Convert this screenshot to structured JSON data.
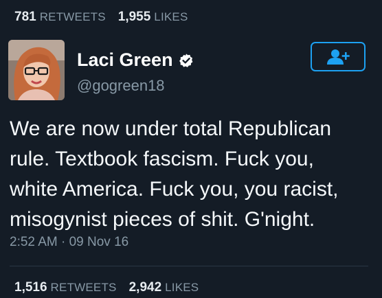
{
  "top_stats": {
    "retweets_count": "781",
    "retweets_label": "RETWEETS",
    "likes_count": "1,955",
    "likes_label": "LIKES"
  },
  "user": {
    "name": "Laci Green",
    "handle": "@gogreen18",
    "verified": true,
    "avatar_icon": "user-avatar-photo"
  },
  "follow_button": {
    "icon": "add-user-icon",
    "color": "#1da1f2"
  },
  "tweet": {
    "text": "We are now under total Republican rule. Textbook fascism. Fuck you, white America. Fuck you, you racist, misogynist pieces of shit. G'night.",
    "timestamp": "2:52 AM · 09 Nov 16"
  },
  "bottom_stats": {
    "retweets_count": "1,516",
    "retweets_label": "RETWEETS",
    "likes_count": "2,942",
    "likes_label": "LIKES"
  },
  "colors": {
    "background": "#141c26",
    "accent": "#1da1f2",
    "muted_text": "#8899a6"
  }
}
